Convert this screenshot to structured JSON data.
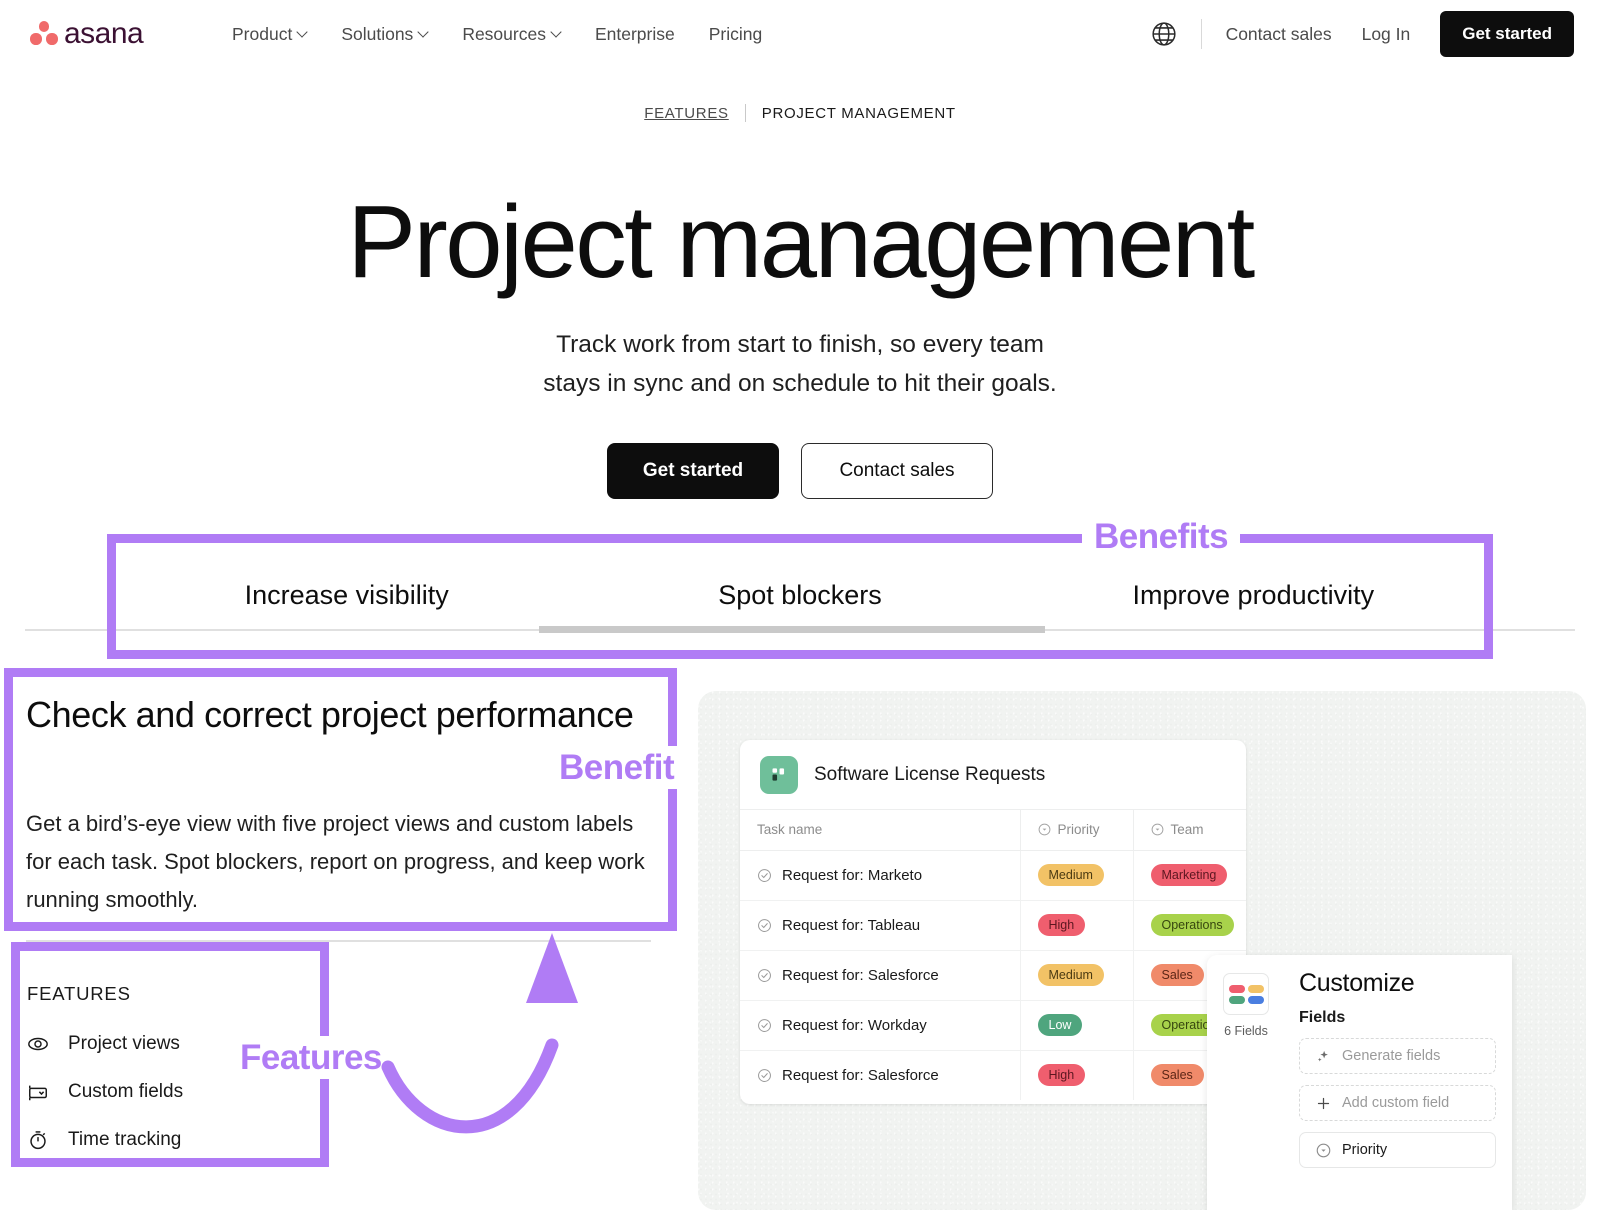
{
  "brand": {
    "name": "asana",
    "dot_color": "#f06a6a",
    "wordmark_color": "#3b1133"
  },
  "nav": {
    "links": [
      {
        "label": "Product",
        "has_caret": true
      },
      {
        "label": "Solutions",
        "has_caret": true
      },
      {
        "label": "Resources",
        "has_caret": true
      },
      {
        "label": "Enterprise",
        "has_caret": false
      },
      {
        "label": "Pricing",
        "has_caret": false
      }
    ],
    "globe_icon": "globe-icon",
    "contact_sales": "Contact sales",
    "log_in": "Log In",
    "get_started": "Get started"
  },
  "breadcrumb": {
    "parent": "FEATURES",
    "current": "PROJECT MANAGEMENT"
  },
  "hero": {
    "title": "Project management",
    "subtitle_line1": "Track work from start to finish, so every team",
    "subtitle_line2": "stays in sync and on schedule to hit their goals.",
    "primary_cta": "Get started",
    "secondary_cta": "Contact sales"
  },
  "tabs": {
    "items": [
      {
        "label": "Increase visibility",
        "active": false
      },
      {
        "label": "Spot blockers",
        "active": true
      },
      {
        "label": "Improve productivity",
        "active": false
      }
    ],
    "active_index": 1,
    "underline_color": "#c9c9c9"
  },
  "benefit": {
    "title": "Check and correct project performance",
    "body": "Get a bird’s-eye view with five project views and custom labels for each task. Spot blockers, report on progress, and keep work running smoothly."
  },
  "features": {
    "label": "FEATURES",
    "items": [
      {
        "label": "Project views",
        "icon": "eye-icon"
      },
      {
        "label": "Custom fields",
        "icon": "custom-field-icon"
      },
      {
        "label": "Time tracking",
        "icon": "stopwatch-icon"
      }
    ]
  },
  "mockup": {
    "project_icon": "asana-project-icon",
    "project_icon_color": "#6fbf9a",
    "project_title": "Software License Requests",
    "columns": [
      {
        "label": "Task name",
        "icon": null
      },
      {
        "label": "Priority",
        "icon": "dropdown-circle-icon"
      },
      {
        "label": "Team",
        "icon": "dropdown-circle-icon"
      }
    ],
    "rows": [
      {
        "task": "Request for: Marketo",
        "priority": "Medium",
        "priority_bg": "#f2c266",
        "priority_fg": "#4a3a12",
        "team": "Marketing",
        "team_bg": "#ef5e6e",
        "team_fg": "#5c1620"
      },
      {
        "task": "Request for: Tableau",
        "priority": "High",
        "priority_bg": "#ef5e6e",
        "priority_fg": "#5c1620",
        "team": "Operations",
        "team_bg": "#a8d24b",
        "team_fg": "#37460f"
      },
      {
        "task": "Request for: Salesforce",
        "priority": "Medium",
        "priority_bg": "#f2c266",
        "priority_fg": "#4a3a12",
        "team": "Sales",
        "team_bg": "#f08a6a",
        "team_fg": "#5c2616"
      },
      {
        "task": "Request for: Workday",
        "priority": "Low",
        "priority_bg": "#4fa57e",
        "priority_fg": "#ffffff",
        "team": "Operations",
        "team_bg": "#a8d24b",
        "team_fg": "#37460f"
      },
      {
        "task": "Request for: Salesforce",
        "priority": "High",
        "priority_bg": "#ef5e6e",
        "priority_fg": "#5c1620",
        "team": "Sales",
        "team_bg": "#f08a6a",
        "team_fg": "#5c2616"
      }
    ],
    "customize": {
      "fields_count": "6 Fields",
      "fields_icon_colors": [
        "#ef5e6e",
        "#f2c266",
        "#4fa57e",
        "#4a7ee0"
      ],
      "title": "Customize",
      "section_label": "Fields",
      "actions": [
        {
          "label": "Generate fields",
          "icon": "sparkle-icon",
          "style": "dashed"
        },
        {
          "label": "Add custom field",
          "icon": "plus-icon",
          "style": "dashed"
        },
        {
          "label": "Priority",
          "icon": "dropdown-circle-icon",
          "style": "solid"
        }
      ]
    }
  },
  "annotations": {
    "color": "#b07cf5",
    "benefits_label": "Benefits",
    "benefit_label": "Benefit",
    "features_label": "Features"
  }
}
